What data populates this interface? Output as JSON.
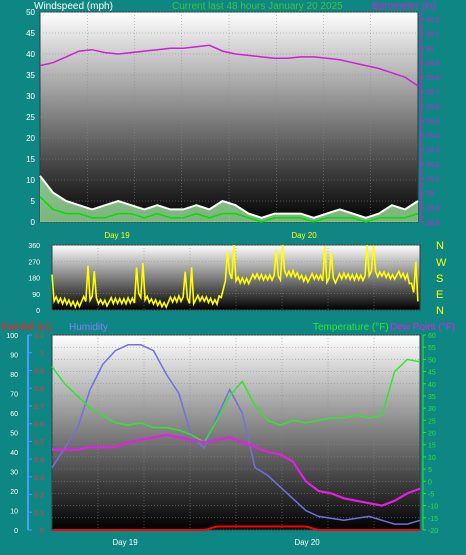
{
  "header": {
    "wind_label": "Windspeed (mph)",
    "current_label": "Current last 48 hours January 20 2025",
    "baro_label": "Barometer (in)"
  },
  "middle": {
    "compass": [
      "N",
      "W",
      "S",
      "E",
      "N"
    ]
  },
  "bottom": {
    "rain_label": "Rainfall (in)",
    "humidity_label": "Humidity",
    "temp_label": "Temperature (°F)",
    "dew_label": "Dew Point (°F)"
  },
  "colors": {
    "background": "#0e8784",
    "wind_avg": "#00e000",
    "wind_gust": "#ffffff",
    "wind_band": "#a8f0a8",
    "barometer": "#d21ed2",
    "direction": "#ffff00",
    "temperature": "#2ee62e",
    "dew_point": "#e61ee6",
    "humidity": "#7070e0",
    "rain": "#ff0000",
    "rain_axis": "#3fa0ff",
    "axis_text": "#ffffff"
  },
  "chart_data": [
    {
      "type": "line",
      "x_ticks": [
        "Day 19",
        "Day 20"
      ],
      "axes": {
        "left": {
          "label": "Windspeed (mph)",
          "ticks": [
            0,
            5,
            10,
            15,
            20,
            25,
            30,
            35,
            40,
            45,
            50
          ],
          "ylim": [
            0,
            50
          ]
        },
        "right": {
          "label": "Barometer (in)",
          "ticks": [
            28.8,
            28.9,
            29,
            29.1,
            29.2,
            29.3,
            29.4,
            29.5,
            29.6,
            29.7,
            29.8,
            29.9,
            30,
            30.1,
            30.2
          ],
          "ylim": [
            28.8,
            30.25
          ]
        }
      },
      "grid": true,
      "series": [
        {
          "axis": "right",
          "values": [
            29.88,
            29.9,
            29.94,
            29.98,
            29.99,
            29.97,
            29.96,
            29.97,
            29.98,
            29.99,
            30,
            30,
            30.01,
            30.02,
            29.98,
            29.96,
            29.95,
            29.94,
            29.93,
            29.93,
            29.94,
            29.94,
            29.93,
            29.92,
            29.9,
            29.88,
            29.86,
            29.83,
            29.8,
            29.74
          ]
        },
        {
          "axis": "left",
          "values": [
            11,
            7,
            5,
            4,
            3,
            4,
            5,
            4,
            3,
            4,
            3,
            3,
            4,
            3,
            5,
            4,
            2,
            1,
            2,
            2,
            2,
            1,
            2,
            3,
            2,
            1,
            2,
            4,
            3,
            5
          ]
        },
        {
          "axis": "left",
          "values": [
            6,
            3,
            2,
            2,
            1,
            1,
            2,
            2,
            1,
            2,
            1,
            1,
            2,
            1,
            2,
            2,
            1,
            0,
            1,
            1,
            1,
            0,
            1,
            1,
            1,
            0,
            1,
            1,
            1,
            2
          ]
        }
      ]
    },
    {
      "type": "line",
      "x_ticks": [
        "Day 19",
        "Day 20"
      ],
      "axes": {
        "left": {
          "label": "",
          "ticks": [
            0,
            90,
            180,
            270,
            360
          ],
          "ylim": [
            0,
            360
          ]
        }
      },
      "grid": true,
      "series": [
        {
          "axis": "left",
          "values": [
            50,
            45,
            40,
            60,
            50,
            40,
            55,
            70,
            45,
            40,
            60,
            60,
            55,
            50,
            180,
            165,
            175,
            180,
            190,
            200,
            180,
            175,
            170,
            180,
            185,
            190,
            200,
            195,
            180,
            50
          ]
        }
      ]
    },
    {
      "type": "line",
      "x_ticks": [
        "Day 19",
        "Day 20"
      ],
      "axes": {
        "left": {
          "label": "Rainfall (in)",
          "ticks": [
            0,
            0.1,
            0.2,
            0.3,
            0.4,
            0.5,
            0.6,
            0.7,
            0.8,
            0.9,
            1,
            1.1
          ],
          "ylim": [
            0,
            1.1
          ]
        },
        "humidity": {
          "label": "Humidity",
          "ticks": [
            0,
            10,
            20,
            30,
            40,
            50,
            60,
            70,
            80,
            90,
            100
          ],
          "ylim": [
            0,
            100
          ]
        },
        "right": {
          "label": "Temperature (°F)",
          "ticks": [
            -20,
            -15,
            -10,
            -5,
            0,
            5,
            10,
            15,
            20,
            25,
            30,
            35,
            40,
            45,
            50,
            55,
            60
          ],
          "ylim": [
            -20,
            60
          ]
        }
      },
      "grid": true,
      "series": [
        {
          "axis": "right",
          "values": [
            47,
            40,
            35,
            30,
            27,
            24,
            23,
            24,
            22,
            22,
            21,
            19,
            16,
            25,
            35,
            41,
            31,
            25,
            23,
            25,
            24,
            25,
            26,
            26,
            27,
            26,
            27,
            45,
            50,
            49
          ]
        },
        {
          "axis": "right",
          "values": [
            13,
            13,
            13,
            14,
            14,
            14,
            16,
            17,
            18,
            19,
            18,
            17,
            16,
            17,
            18,
            16,
            14,
            12,
            11,
            8,
            0,
            -4,
            -5,
            -7,
            -8,
            -9,
            -10,
            -8,
            -5,
            -3
          ]
        },
        {
          "axis": "humidity",
          "values": [
            32,
            42,
            52,
            72,
            85,
            92,
            95,
            95,
            92,
            80,
            70,
            48,
            42,
            58,
            72,
            60,
            32,
            28,
            22,
            16,
            10,
            7,
            6,
            5,
            6,
            7,
            5,
            3,
            3,
            5
          ]
        },
        {
          "axis": "left",
          "values": [
            0,
            0,
            0,
            0,
            0,
            0,
            0,
            0,
            0,
            0,
            0,
            0,
            0,
            0.02,
            0.02,
            0.02,
            0.02,
            0.02,
            0.02,
            0.02,
            0.02,
            0,
            0,
            0,
            0,
            0,
            0,
            0,
            0,
            0
          ]
        }
      ]
    }
  ]
}
